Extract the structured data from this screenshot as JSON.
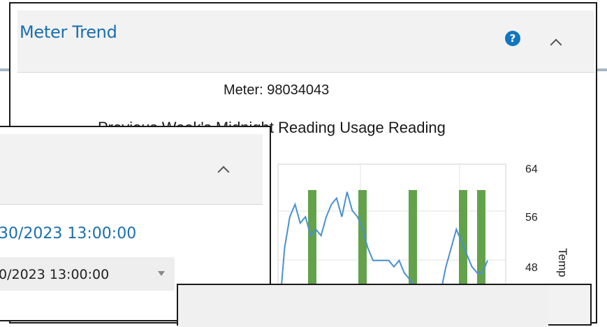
{
  "meter_trend": {
    "title": "Meter Trend",
    "meter_label": "Meter: 98034043",
    "chart_title": "Previous Week's Midnight Reading Usage Reading",
    "help_icon": "question-circle-icon",
    "collapse_icon": "chevron-up-icon"
  },
  "left_panel": {
    "collapse_icon": "chevron-up-icon",
    "date_link": "30/2023 13:00:00",
    "select_value": "0/2023 13:00:00"
  },
  "colors": {
    "accent": "#1a6fae",
    "bar": "#63a24b",
    "line": "#4a90d0"
  },
  "chart_data": {
    "type": "bar",
    "title": "Previous Week's Midnight Reading Usage Reading",
    "y2_ticks": [
      "64",
      "56",
      "48"
    ],
    "y2_label": "Temp",
    "y2lim": [
      40,
      64
    ],
    "bars": [
      {
        "x": 0.36,
        "value": 1
      },
      {
        "x": 0.4,
        "value": 1
      },
      {
        "x": 0.49,
        "value": 1
      },
      {
        "x": 0.58,
        "value": 1
      },
      {
        "x": 0.62,
        "value": 1
      }
    ],
    "series": [
      {
        "values_temp": [
          40,
          50,
          55,
          57,
          54,
          55,
          52,
          53,
          52,
          55,
          57,
          58,
          55,
          59,
          56,
          55,
          53,
          50,
          48,
          48,
          48,
          48,
          47,
          48,
          46,
          45,
          44,
          40,
          41,
          40,
          40,
          43,
          47,
          50,
          53,
          51,
          49,
          47,
          46,
          46,
          48
        ]
      }
    ]
  }
}
